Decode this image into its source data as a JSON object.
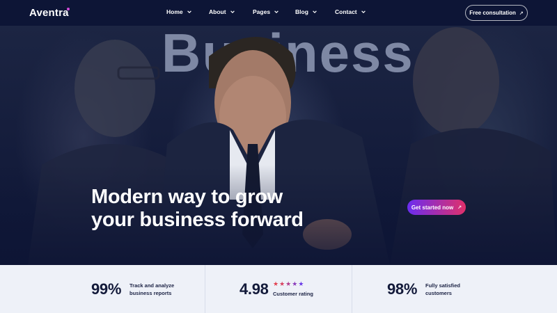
{
  "brand": {
    "name": "Aventra",
    "dot_color": "#d14bd8"
  },
  "nav": {
    "items": [
      {
        "label": "Home"
      },
      {
        "label": "About"
      },
      {
        "label": "Pages"
      },
      {
        "label": "Blog"
      },
      {
        "label": "Contact"
      }
    ],
    "cta_label": "Free consultation"
  },
  "hero": {
    "background_word": "Business",
    "headline_line1": "Modern way to grow",
    "headline_line2": "your business forward",
    "cta_label": "Get started now",
    "cta_gradient": [
      "#6a2df0",
      "#e0306a"
    ]
  },
  "stats": [
    {
      "value": "99%",
      "text_line1": "Track and analyze",
      "text_line2": "business reports"
    },
    {
      "value": "4.98",
      "rating_label": "Customer rating",
      "stars": 5,
      "star_color": "#e2404f",
      "star_color_alt": "#6b3ce8"
    },
    {
      "value": "98%",
      "text_line1": "Fully satisfied",
      "text_line2": "customers"
    }
  ],
  "colors": {
    "nav_bg": "#0d1536",
    "hero_bg": "#141c3b",
    "stats_bg": "#eef1f8",
    "text_dark": "#131a3a"
  }
}
